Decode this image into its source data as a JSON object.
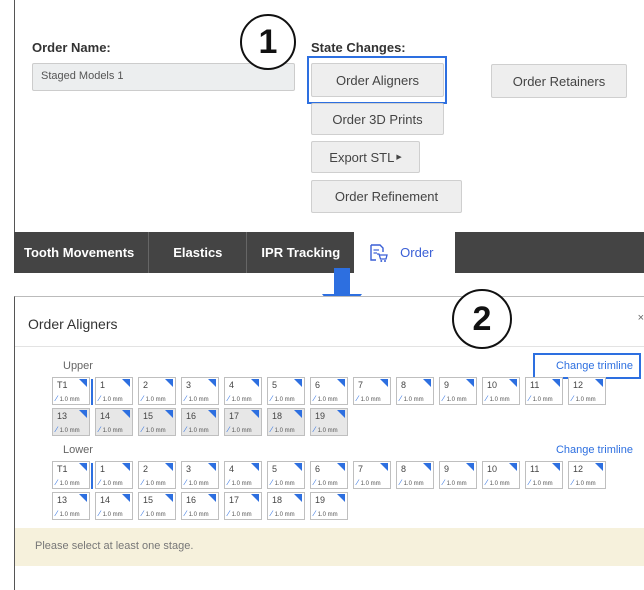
{
  "top": {
    "order_name_label": "Order Name:",
    "order_name_value": "Staged Models 1",
    "state_changes_label": "State Changes:",
    "buttons": {
      "order_aligners": "Order Aligners",
      "order_retainers": "Order Retainers",
      "order_3d_prints": "Order 3D Prints",
      "export_stl": "Export STL",
      "order_refinement": "Order Refinement"
    }
  },
  "callouts": {
    "one": "1",
    "two": "2"
  },
  "tabs": [
    {
      "label": "Tooth Movements"
    },
    {
      "label": "Elastics"
    },
    {
      "label": "IPR Tracking"
    },
    {
      "label": "Order"
    }
  ],
  "modal": {
    "title": "Order Aligners",
    "close": "×",
    "upper_label": "Upper",
    "lower_label": "Lower",
    "change_trimline": "Change trimline",
    "notice": "Please select at least one stage."
  },
  "stages": {
    "mm_label": "1.0 mm",
    "upper_row1": [
      "T1",
      "1",
      "2",
      "3",
      "4",
      "5",
      "6",
      "7",
      "8",
      "9",
      "10",
      "11",
      "12"
    ],
    "upper_row2": [
      "13",
      "14",
      "15",
      "16",
      "17",
      "18",
      "19"
    ],
    "lower_row1": [
      "T1",
      "1",
      "2",
      "3",
      "4",
      "5",
      "6",
      "7",
      "8",
      "9",
      "10",
      "11",
      "12"
    ],
    "lower_row2": [
      "13",
      "14",
      "15",
      "16",
      "17",
      "18",
      "19"
    ]
  },
  "colors": {
    "accent": "#2d6fe0",
    "tabbar": "#444444",
    "notice_bg": "#f6f1dc"
  },
  "icons": {
    "order_tab": "cart-document-icon",
    "down_arrow": "down-arrow-icon",
    "close": "close-icon"
  }
}
